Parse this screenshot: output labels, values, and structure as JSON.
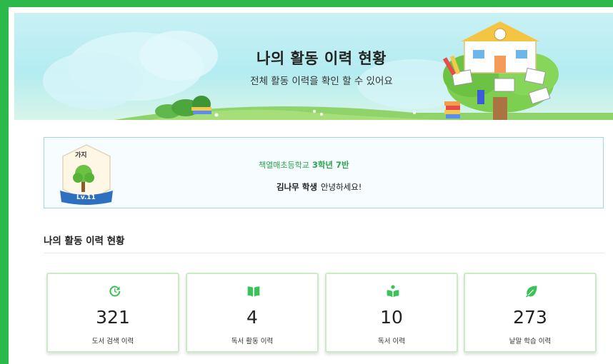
{
  "banner": {
    "title": "나의 활동 이력 현황",
    "subtitle": "전체 활동 이력을 확인 할 수 있어요"
  },
  "profile": {
    "badge_level_name": "가지",
    "badge_level": "Lv.11",
    "school": "책열매초등학교",
    "grade_class": "3학년 7반",
    "student_name": "김나무 학생",
    "greeting": "안녕하세요!"
  },
  "section": {
    "title": "나의 활동 이력 현황"
  },
  "stats": [
    {
      "icon": "history-icon",
      "count": "321",
      "label": "도서 검색 이력"
    },
    {
      "icon": "book-open-icon",
      "count": "4",
      "label": "독서 활동 이력"
    },
    {
      "icon": "reader-icon",
      "count": "10",
      "label": "독서 이력"
    },
    {
      "icon": "leaf-icon",
      "count": "273",
      "label": "낱말 학습 이력"
    }
  ],
  "colors": {
    "accent_green": "#2db84a",
    "icon_green": "#3cc25a",
    "profile_border": "#9fd4ec"
  }
}
